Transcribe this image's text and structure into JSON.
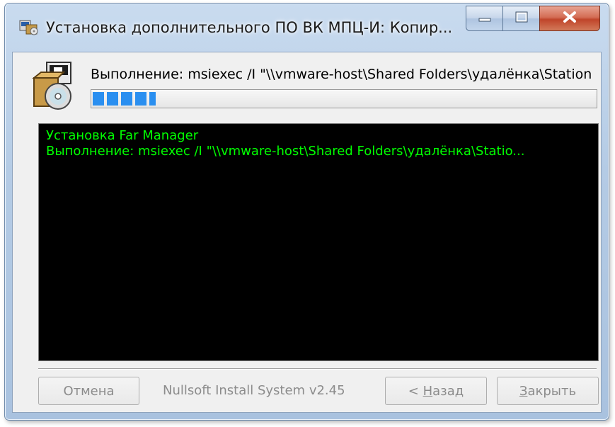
{
  "window": {
    "title": "Установка дополнительного ПО ВК МПЦ-И: Копир..."
  },
  "status": {
    "text": "Выполнение: msiexec /I \"\\\\vmware-host\\Shared Folders\\удалёнка\\Station",
    "progress_percent": 13
  },
  "log": {
    "lines": [
      "Установка Far Manager",
      "Выполнение: msiexec /I \"\\\\vmware-host\\Shared Folders\\удалёнка\\Statio..."
    ]
  },
  "footer": {
    "cancel_label": "Отмена",
    "brand": "Nullsoft Install System v2.45",
    "back_prefix": "< ",
    "back_mnemonic": "Н",
    "back_rest": "азад",
    "close_mnemonic": "З",
    "close_rest": "акрыть"
  },
  "colors": {
    "log_text": "#00ff00",
    "log_background": "#000000",
    "progress_fill": "#2a8ff0"
  },
  "icons": {
    "title": "installer-app-icon",
    "package": "installer-package-cd-icon",
    "minimize": "minimize-icon",
    "maximize": "maximize-icon",
    "close": "close-icon"
  }
}
